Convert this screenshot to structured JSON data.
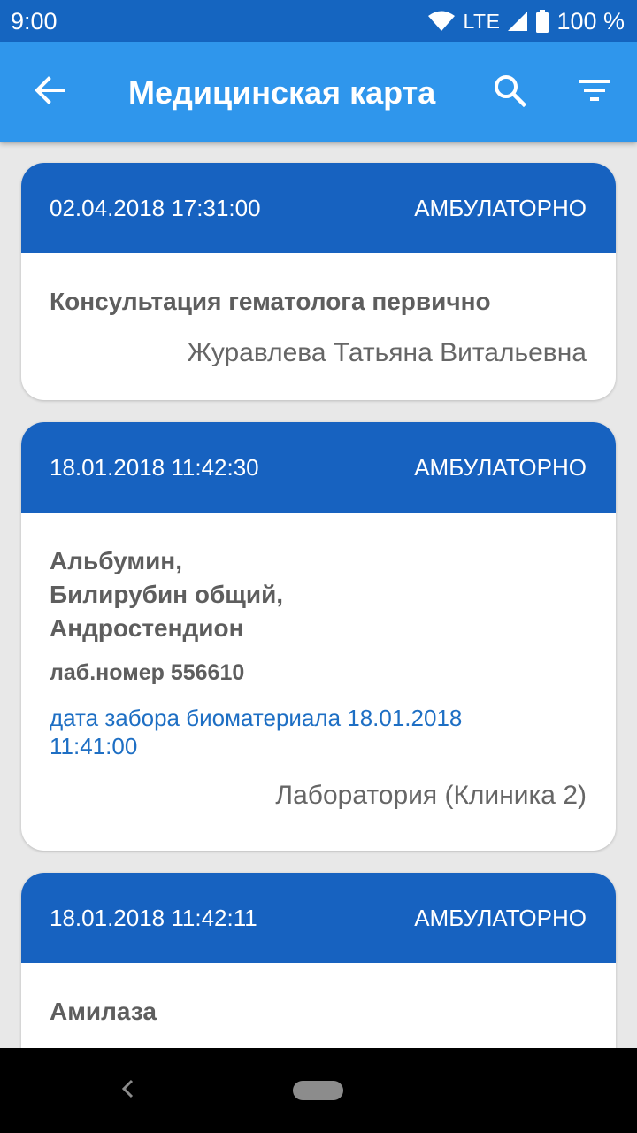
{
  "status_bar": {
    "time": "9:00",
    "network": "LTE",
    "battery": "100 %"
  },
  "app_bar": {
    "title": "Медицинская карта",
    "icons": [
      "arrow-back-icon",
      "search-icon",
      "filter-icon"
    ]
  },
  "cards": [
    {
      "datetime": "02.04.2018 17:31:00",
      "type": "АМБУЛАТОРНО",
      "title_lines": [
        "Консультация гематолога первично"
      ],
      "performer": "Журавлева Татьяна Витальевна"
    },
    {
      "datetime": "18.01.2018 11:42:30",
      "type": "АМБУЛАТОРНО",
      "title_lines": [
        "Альбумин,",
        "Билирубин общий,",
        "Андростендион"
      ],
      "lab_number": "лаб.номер 556610",
      "sample_date": "дата забора биоматериала 18.01.2018 11:41:00",
      "performer": "Лаборатория (Клиника 2)"
    },
    {
      "datetime": "18.01.2018 11:42:11",
      "type": "АМБУЛАТОРНО",
      "title_lines": [
        "Амилаза"
      ]
    }
  ],
  "colors": {
    "status_bar": "#1565c0",
    "app_bar": "#2f96ec",
    "card_header": "#1762c0",
    "link_text": "#1e6fc4",
    "background": "#e8e8e8"
  }
}
